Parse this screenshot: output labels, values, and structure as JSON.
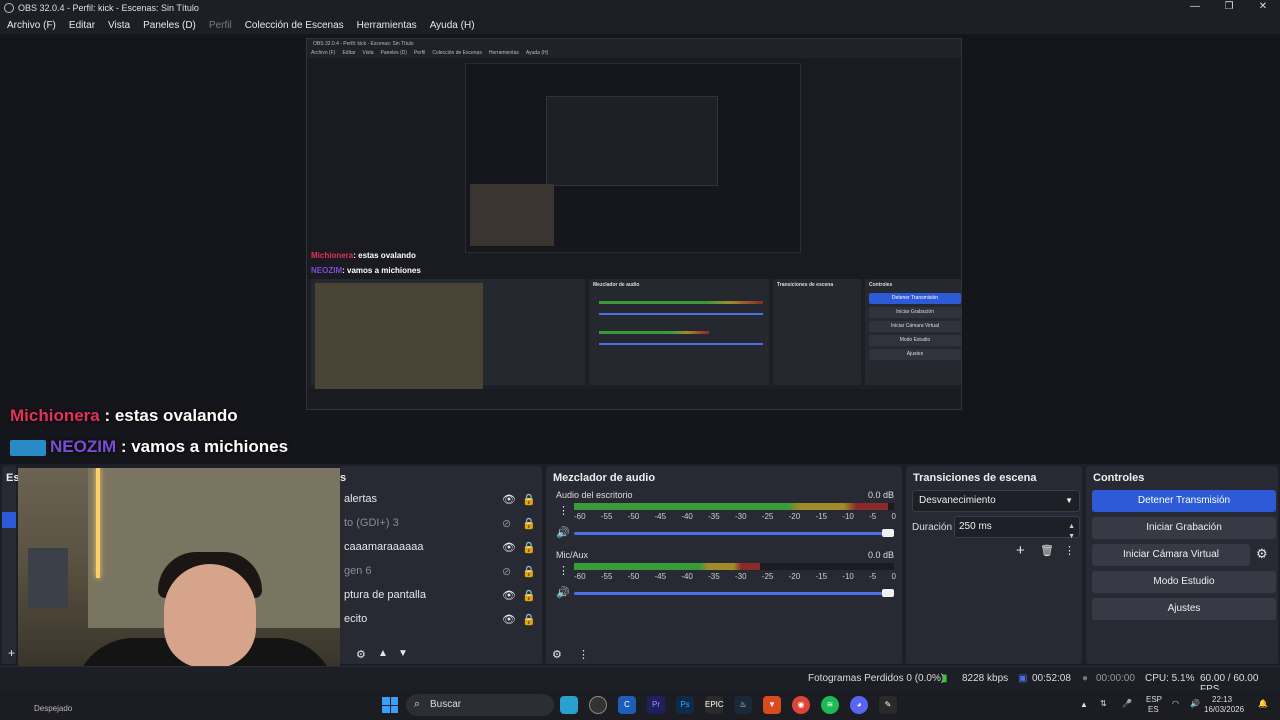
{
  "window": {
    "title": "OBS 32.0.4 - Perfil: kick - Escenas: Sin Título",
    "controls": [
      "—",
      "❐",
      "✕"
    ]
  },
  "menu": {
    "items": [
      "Archivo (F)",
      "Editar",
      "Vista",
      "Paneles (D)",
      "Perfil",
      "Colección de Escenas",
      "Herramientas",
      "Ayuda (H)"
    ]
  },
  "preview": {
    "chat": [
      {
        "user": "Michionera",
        "text": ": estas ovalando"
      },
      {
        "user": "NEOZIM",
        "text": ": vamos a michiones"
      }
    ]
  },
  "overlay_chat": {
    "line1_user": "Michionera",
    "line1_text": " : estas ovalando",
    "line2_user": "NEOZIM",
    "line2_text": " : vamos a michiones"
  },
  "sources": {
    "title": "Fuentes",
    "items": [
      {
        "label": "alertas",
        "visible": true
      },
      {
        "label": "to (GDI+) 3",
        "visible": false
      },
      {
        "label": "caaamaraaaaaa",
        "visible": true
      },
      {
        "label": "gen 6",
        "visible": false
      },
      {
        "label": "ptura de pantalla",
        "visible": true
      },
      {
        "label": "ecito",
        "visible": true
      }
    ]
  },
  "scenes": {
    "title": "Esc"
  },
  "mixer": {
    "title": "Mezclador de audio",
    "channels": [
      {
        "name": "Audio del escritorio",
        "db": "0.0 dB",
        "level": 0.98
      },
      {
        "name": "Mic/Aux",
        "db": "0.0 dB",
        "level": 0.58
      }
    ],
    "scale": [
      "-60",
      "-55",
      "-50",
      "-45",
      "-40",
      "-35",
      "-30",
      "-25",
      "-20",
      "-15",
      "-10",
      "-5",
      "0"
    ]
  },
  "transitions": {
    "title": "Transiciones de escena",
    "selected": "Desvanecimiento",
    "duration_label": "Duración",
    "duration_value": "250 ms"
  },
  "controls": {
    "title": "Controles",
    "stop_stream": "Detener Transmisión",
    "start_recording": "Iniciar Grabación",
    "start_virtual_cam": "Iniciar Cámara Virtual",
    "studio_mode": "Modo Estudio",
    "settings": "Ajustes"
  },
  "status": {
    "dropped_frames": "Fotogramas Perdidos 0 (0.0%)",
    "bitrate": "8228 kbps",
    "stream_time": "00:52:08",
    "rec_time": "00:00:00",
    "cpu": "CPU: 5.1%",
    "fps": "60.00 / 60.00 FPS"
  },
  "taskbar": {
    "search_placeholder": "Buscar",
    "weather": "Despejado",
    "lang1": "ESP",
    "lang2": "ES",
    "time": "22:13",
    "date": "16/03/2026",
    "apps": [
      "files",
      "obs",
      "ccleaner",
      "premiere",
      "photoshop",
      "epic",
      "steam",
      "brave",
      "chrome",
      "spotify",
      "discord",
      "pen"
    ]
  },
  "colors": {
    "accent": "#2d5bd7",
    "meter_green": "#3a9a3a",
    "meter_yellow": "#a08a2a",
    "meter_red": "#8a2a2a",
    "user1": "#e0325a",
    "user2": "#7b4dd6"
  }
}
